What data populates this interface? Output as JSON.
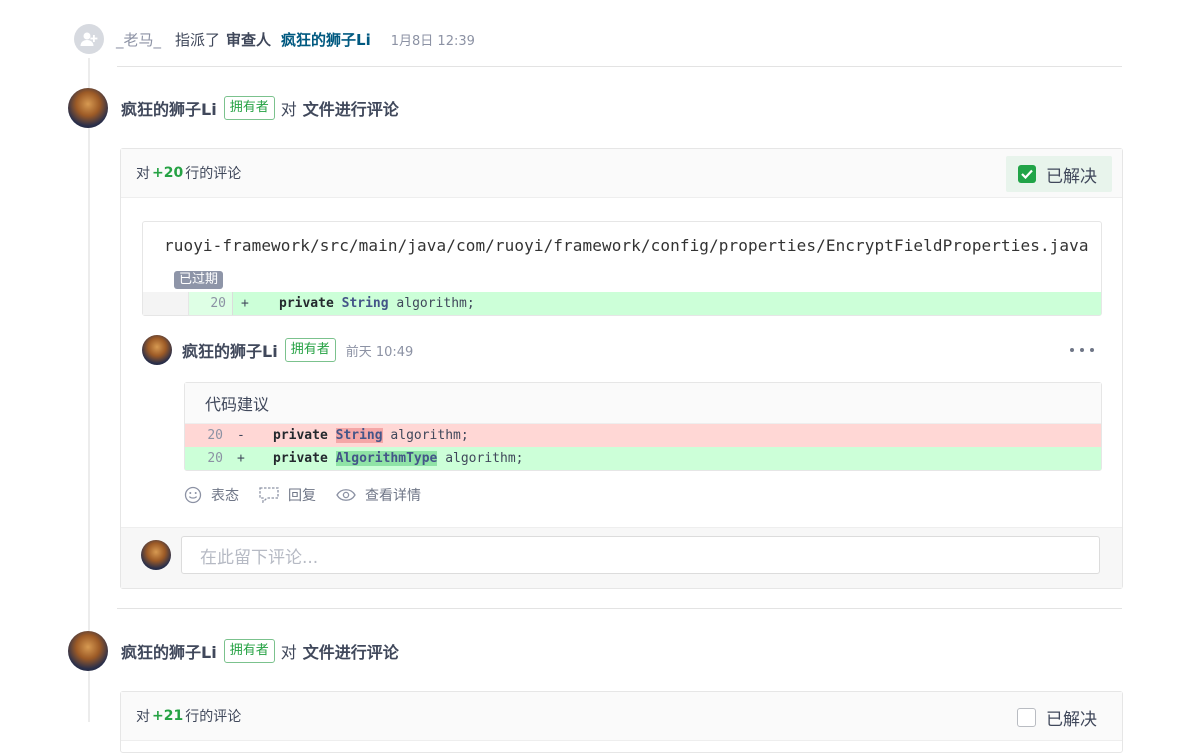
{
  "event": {
    "user": "_老马_",
    "verb": "指派了",
    "role": "审查人",
    "target": "疯狂的狮子Li",
    "time": "1月8日 12:39"
  },
  "comments": [
    {
      "author": "疯狂的狮子Li",
      "badge": "拥有者",
      "dui": "对",
      "action": "文件进行评论",
      "line_prefix": "对",
      "line_ref": "+20",
      "line_suffix": "行的评论",
      "resolved_label": "已解决",
      "resolved": true,
      "file_path": "ruoyi-framework/src/main/java/com/ruoyi/framework/config/properties/EncryptFieldProperties.java",
      "outdated_label": "已过期",
      "diff": {
        "line_no": "20",
        "sign": "+",
        "kw": "private",
        "type": "String",
        "rest": "algorithm;"
      },
      "reply": {
        "author": "疯狂的狮子Li",
        "badge": "拥有者",
        "time": "前天 10:49",
        "suggest_title": "代码建议",
        "lines": [
          {
            "line_no": "20",
            "sign": "-",
            "kw": "private",
            "type": "String",
            "rest": "algorithm;"
          },
          {
            "line_no": "20",
            "sign": "+",
            "kw": "private",
            "type": "AlgorithmType",
            "rest": "algorithm;"
          }
        ],
        "actions": {
          "react": "表态",
          "reply": "回复",
          "details": "查看详情"
        }
      },
      "input_placeholder": "在此留下评论..."
    },
    {
      "author": "疯狂的狮子Li",
      "badge": "拥有者",
      "dui": "对",
      "action": "文件进行评论",
      "line_prefix": "对",
      "line_ref": "+21",
      "line_suffix": "行的评论",
      "resolved_label": "已解决",
      "resolved": false
    }
  ],
  "colors": {
    "accent_green": "#26a244",
    "link_blue": "#005980",
    "add_bg": "#ccffd8",
    "del_bg": "#ffd7d5"
  }
}
